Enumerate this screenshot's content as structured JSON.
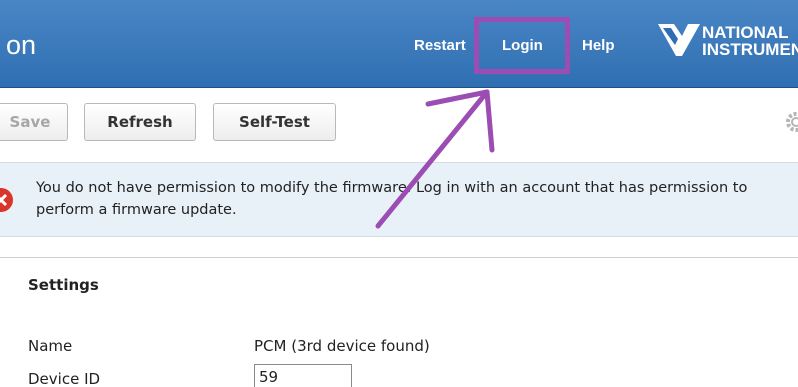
{
  "header": {
    "title": "on",
    "nav": {
      "restart": "Restart",
      "login": "Login",
      "help": "Help"
    },
    "logo": {
      "line1": "NATIONAL",
      "line2": "INSTRUMENTS"
    }
  },
  "toolbar": {
    "save_label": "Save",
    "refresh_label": "Refresh",
    "selftest_label": "Self-Test"
  },
  "notice": {
    "message": "You do not have permission to modify the firmware. Log in with an account that has permission to perform a firmware update."
  },
  "settings": {
    "heading": "Settings",
    "name_label": "Name",
    "name_value": "PCM (3rd device found)",
    "device_id_label": "Device ID",
    "device_id_value": "59"
  },
  "colors": {
    "header_blue": "#2f6fb1",
    "highlight": "#9b4db4",
    "notice_bg": "#e8f0f8",
    "error_red": "#d9352b"
  },
  "icons": [
    "ni-logo-icon",
    "gear-icon",
    "error-icon"
  ]
}
